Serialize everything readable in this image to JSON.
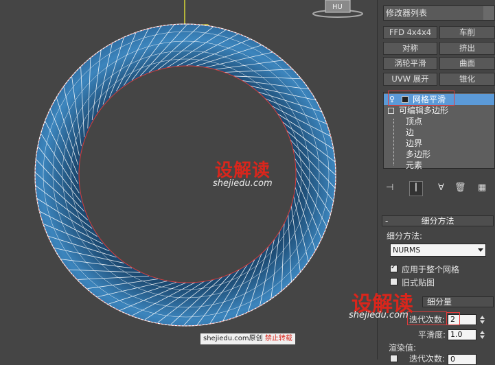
{
  "viewport": {
    "hu_label": "HU",
    "watermark_brand": "设解读",
    "watermark_url": "shejiedu.com",
    "credit_text": "shejiedu.com原创",
    "credit_warning": "禁止转载"
  },
  "panel": {
    "modifier_list": "修改器列表",
    "buttons": [
      {
        "label": "FFD 4x4x4"
      },
      {
        "label": "车削"
      },
      {
        "label": "对称"
      },
      {
        "label": "挤出"
      },
      {
        "label": "涡轮平滑"
      },
      {
        "label": "曲面"
      },
      {
        "label": "UVW 展开"
      },
      {
        "label": "锥化"
      }
    ],
    "stack": {
      "items": [
        "网格平滑",
        "可编辑多边形",
        "顶点",
        "边",
        "边界",
        "多边形",
        "元素"
      ]
    },
    "subdiv_method": {
      "rollout_title": "细分方法",
      "method_label": "细分方法:",
      "method_value": "NURMS",
      "apply_whole_mesh": "应用于整个网格",
      "old_style_mapping": "旧式贴图"
    },
    "subdiv_amount": {
      "rollout_title": "细分量",
      "iterations_label": "迭代次数:",
      "iterations_value": "2",
      "smoothness_label": "平滑度:",
      "smoothness_value": "1.0",
      "render_values_label": "渲染值:",
      "render_iterations_label": "迭代次数:",
      "render_iterations_value": "0"
    },
    "watermark_brand": "设解读",
    "watermark_url": "shejiedu.com"
  },
  "colors": {
    "accent_red": "#d9261c",
    "selection_blue": "#5b9ad8",
    "torus_blue": "#2c6fa3"
  }
}
